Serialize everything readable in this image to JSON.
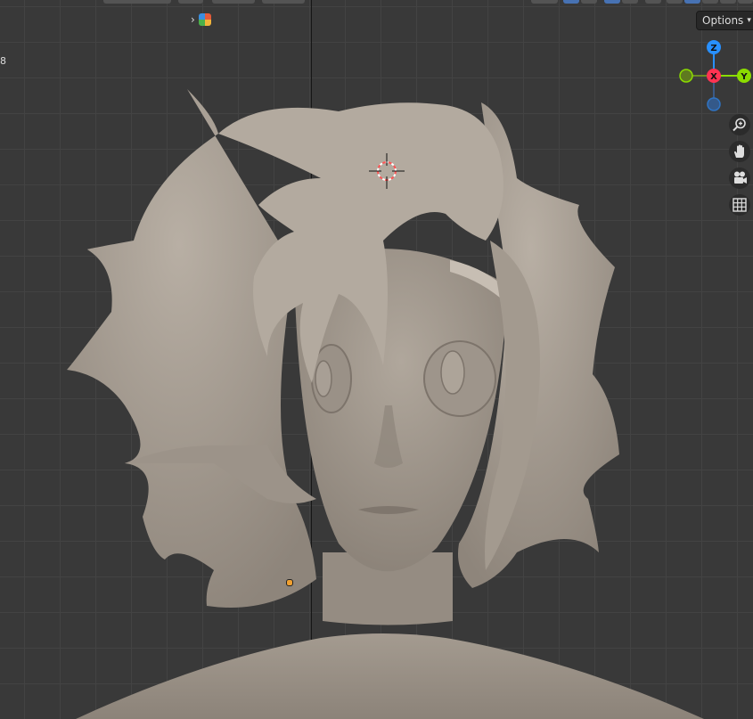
{
  "viewport": {
    "frame_label": "8",
    "options_label": "Options",
    "colors": {
      "background": "#393939",
      "grid": "#434343",
      "axis_x": "#ff3352",
      "axis_y": "#8bdc00",
      "axis_z": "#2890ff",
      "model": "#a39a8f",
      "accent": "#4772b3"
    }
  },
  "gizmo": {
    "z_label": "Z",
    "x_label": "X",
    "y_label": "Y"
  },
  "nav_tools": [
    {
      "name": "zoom-icon"
    },
    {
      "name": "hand-icon"
    },
    {
      "name": "camera-icon"
    },
    {
      "name": "grid-icon"
    }
  ]
}
